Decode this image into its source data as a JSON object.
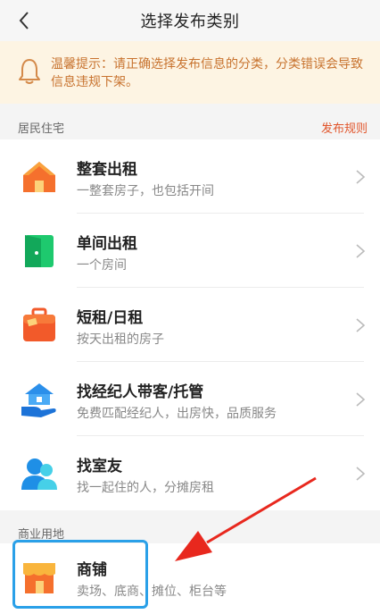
{
  "header": {
    "title": "选择发布类别",
    "back_icon": "chevron-left-icon"
  },
  "notice": {
    "icon": "bell-icon",
    "text": "温馨提示：请正确选择发布信息的分类，分类错误会导致信息违规下架。",
    "color": "#c8732f",
    "background": "#fdf4e3"
  },
  "sections": [
    {
      "label": "居民住宅",
      "link": "发布规则",
      "items": [
        {
          "title": "整套出租",
          "subtitle": "一整套房子，也包括开间",
          "icon": "house-icon"
        },
        {
          "title": "单间出租",
          "subtitle": "一个房间",
          "icon": "door-icon"
        },
        {
          "title": "短租/日租",
          "subtitle": "按天出租的房子",
          "icon": "suitcase-icon"
        },
        {
          "title": "找经纪人带客/托管",
          "subtitle": "免费匹配经纪人，出房快，品质服务",
          "icon": "hand-house-icon"
        },
        {
          "title": "找室友",
          "subtitle": "找一起住的人，分摊房租",
          "icon": "roommates-icon"
        }
      ]
    },
    {
      "label": "商业用地",
      "items": [
        {
          "title": "商铺",
          "subtitle": "卖场、底商、摊位、柜台等",
          "icon": "shop-icon"
        }
      ]
    }
  ],
  "colors": {
    "accent": "#e1552b",
    "highlight": "#2aa0e8",
    "arrow": "#e8281e"
  }
}
